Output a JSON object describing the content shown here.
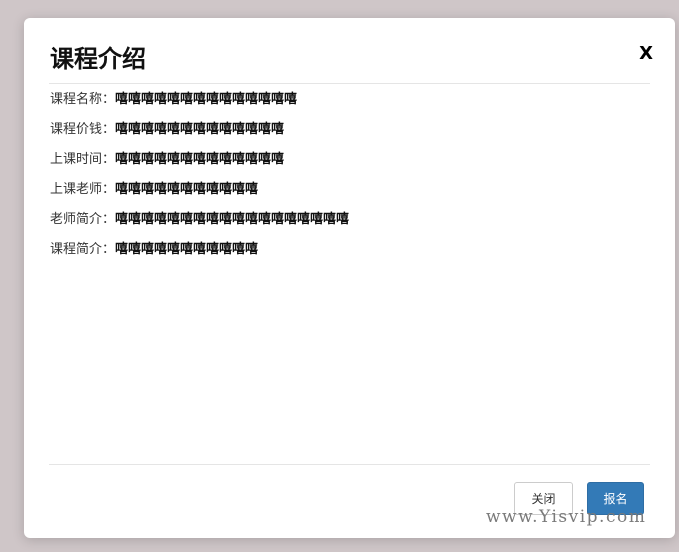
{
  "modal": {
    "title": "课程介绍",
    "close_icon": "X",
    "rows": [
      {
        "label": "课程名称：",
        "value": "嘻嘻嘻嘻嘻嘻嘻嘻嘻嘻嘻嘻嘻嘻"
      },
      {
        "label": "课程价钱：",
        "value": "嘻嘻嘻嘻嘻嘻嘻嘻嘻嘻嘻嘻嘻"
      },
      {
        "label": "上课时间：",
        "value": "嘻嘻嘻嘻嘻嘻嘻嘻嘻嘻嘻嘻嘻"
      },
      {
        "label": "上课老师：",
        "value": "嘻嘻嘻嘻嘻嘻嘻嘻嘻嘻嘻"
      },
      {
        "label": "老师简介：",
        "value": "嘻嘻嘻嘻嘻嘻嘻嘻嘻嘻嘻嘻嘻嘻嘻嘻嘻嘻"
      },
      {
        "label": "课程简介：",
        "value": "嘻嘻嘻嘻嘻嘻嘻嘻嘻嘻嘻"
      }
    ],
    "footer": {
      "close_label": "关闭",
      "enroll_label": "报名"
    }
  },
  "watermark": "www.Yisvip.com",
  "colors": {
    "backdrop": "#cfc6c8",
    "primary_button": "#337ab7"
  }
}
